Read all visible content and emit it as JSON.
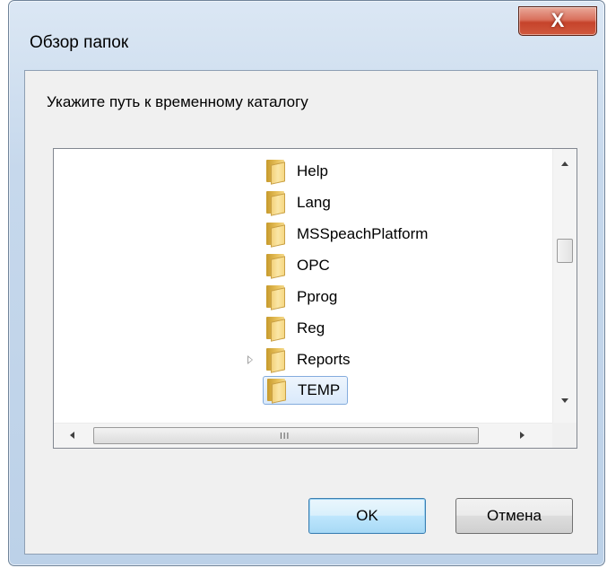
{
  "window": {
    "title": "Обзор папок",
    "close_label": "X"
  },
  "prompt": "Укажите путь к временному каталогу",
  "tree": {
    "items": [
      {
        "label": "Help",
        "selected": false,
        "has_children": false
      },
      {
        "label": "Lang",
        "selected": false,
        "has_children": false
      },
      {
        "label": "MSSpeachPlatform",
        "selected": false,
        "has_children": false
      },
      {
        "label": "OPC",
        "selected": false,
        "has_children": false
      },
      {
        "label": "Pprog",
        "selected": false,
        "has_children": false
      },
      {
        "label": "Reg",
        "selected": false,
        "has_children": false
      },
      {
        "label": "Reports",
        "selected": false,
        "has_children": true
      },
      {
        "label": "TEMP",
        "selected": true,
        "has_children": false
      }
    ],
    "hscroll_grip": "III"
  },
  "buttons": {
    "ok": "OK",
    "cancel": "Отмена"
  },
  "colors": {
    "selection_border": "#84acdd",
    "default_button_border": "#3c7fb1",
    "close_button": "#c6432b"
  }
}
